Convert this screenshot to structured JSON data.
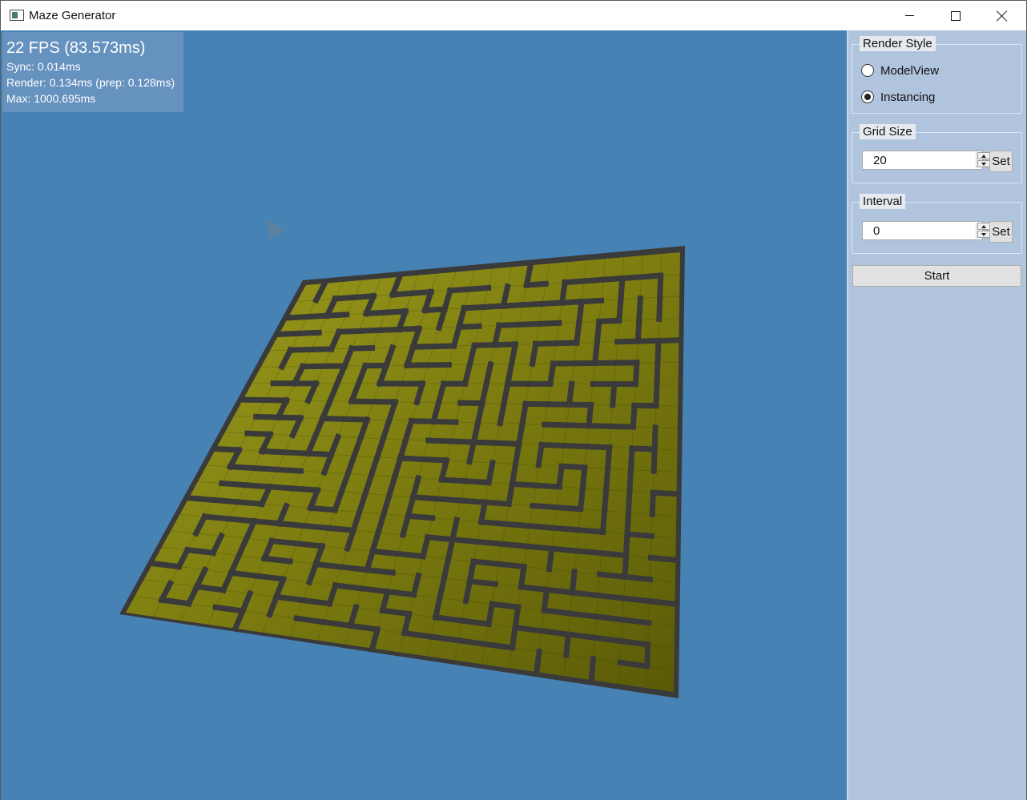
{
  "window": {
    "title": "Maze Generator"
  },
  "stats": {
    "fps": "22 FPS (83.573ms)",
    "sync": "Sync: 0.014ms",
    "render": "Render: 0.134ms (prep: 0.128ms)",
    "max": "Max: 1000.695ms"
  },
  "panel": {
    "render_style": {
      "legend": "Render Style",
      "options": [
        {
          "label": "ModelView",
          "selected": false
        },
        {
          "label": "Instancing",
          "selected": true
        }
      ]
    },
    "grid_size": {
      "legend": "Grid Size",
      "value": "20",
      "set_label": "Set"
    },
    "interval": {
      "legend": "Interval",
      "value": "0",
      "set_label": "Set"
    },
    "start_label": "Start"
  },
  "maze": {
    "grid_size": 20,
    "floor_color": "#7a7a10",
    "wall_color": "#3a3a3a",
    "background": "#4682b4"
  }
}
